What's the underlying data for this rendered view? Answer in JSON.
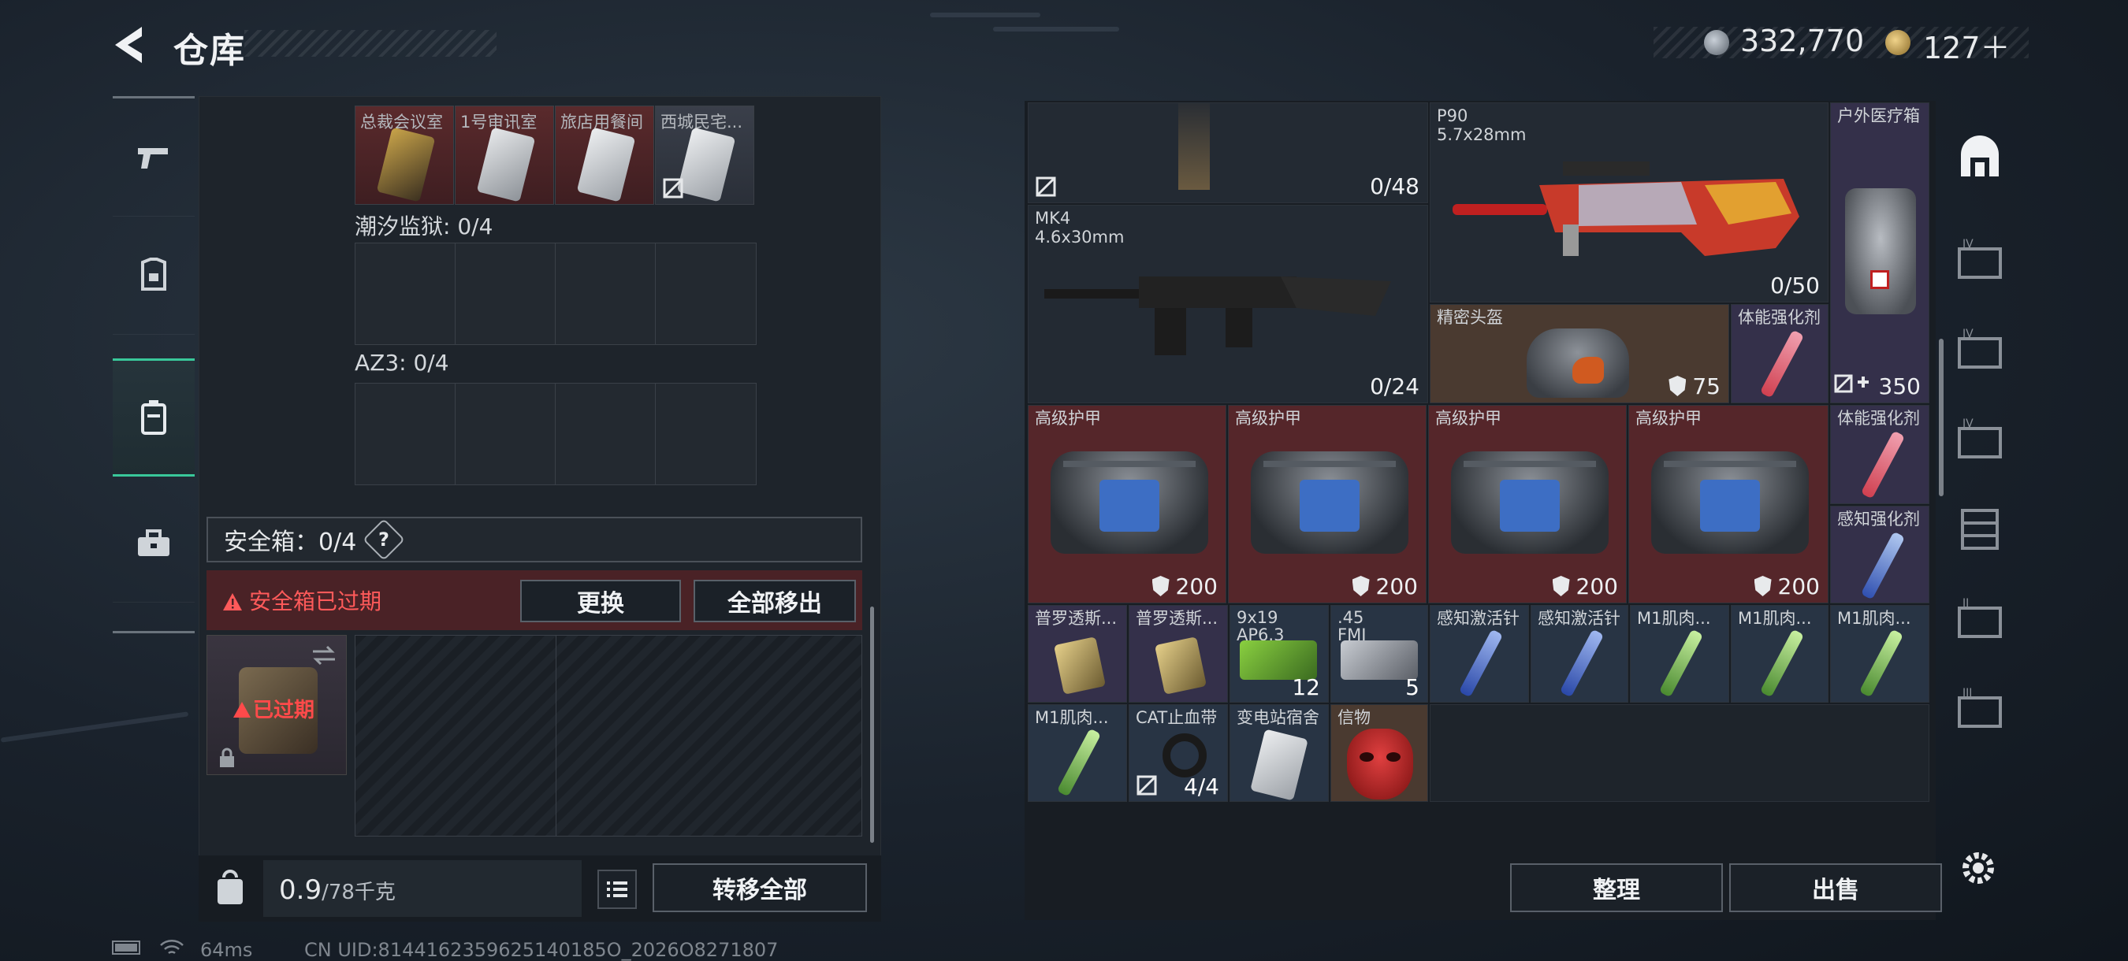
{
  "header": {
    "title": "仓库",
    "money": "332,770",
    "tokens": "127＋"
  },
  "keycards": [
    {
      "label": "总裁会议室",
      "color": "red"
    },
    {
      "label": "1号审讯室",
      "color": "red"
    },
    {
      "label": "旅店用餐间",
      "color": "red"
    },
    {
      "label": "西城民宅...",
      "color": "gray"
    }
  ],
  "sections": {
    "prison": "潮汐监狱: 0/4",
    "az3": "AZ3: 0/4"
  },
  "safebox": {
    "label": "安全箱：0/4",
    "help": "?",
    "expired_warning": "安全箱已过期",
    "swap_button": "更换",
    "move_all_button": "全部移出",
    "expired_tag": "已过期"
  },
  "weight": {
    "value": "0.9",
    "unit": "/78千克"
  },
  "transfer_all_button": "转移全部",
  "right_buttons": {
    "sort": "整理",
    "sell": "出售"
  },
  "items": {
    "mag_count": "0/48",
    "p90": {
      "name": "P90",
      "caliber": "5.7x28mm",
      "ammo": "0/50"
    },
    "medbox": {
      "name": "户外医疗箱",
      "value": "350"
    },
    "mk4": {
      "name": "MK4",
      "caliber": "4.6x30mm",
      "ammo": "0/24"
    },
    "helmet": {
      "name": "精密头盔",
      "armor": "75"
    },
    "stim_body1": {
      "name": "体能强化剂"
    },
    "stim_body2": {
      "name": "体能强化剂"
    },
    "stim_sense": {
      "name": "感知强化剂"
    },
    "armors": [
      {
        "name": "高级护甲",
        "armor": "200"
      },
      {
        "name": "高级护甲",
        "armor": "200"
      },
      {
        "name": "高级护甲",
        "armor": "200"
      },
      {
        "name": "高级护甲",
        "armor": "200"
      }
    ],
    "row3": [
      {
        "name": "普罗透斯...",
        "count": ""
      },
      {
        "name": "普罗透斯...",
        "count": ""
      },
      {
        "name": "9x19 AP6.3",
        "count": "12"
      },
      {
        "name": ".45 FMJ",
        "count": "5"
      },
      {
        "name": "感知激活针",
        "count": ""
      },
      {
        "name": "感知激活针",
        "count": ""
      },
      {
        "name": "M1肌肉...",
        "count": ""
      },
      {
        "name": "M1肌肉...",
        "count": ""
      },
      {
        "name": "M1肌肉...",
        "count": ""
      }
    ],
    "row4": [
      {
        "name": "M1肌肉...",
        "count": ""
      },
      {
        "name": "CAT止血带",
        "count": "4/4"
      },
      {
        "name": "变电站宿舍",
        "count": ""
      },
      {
        "name": "信物",
        "count": ""
      }
    ]
  },
  "status": {
    "ping": "64ms",
    "uid": "CN UID:8144162359625140185O_2026O8271807"
  },
  "colors": {
    "accent": "#39c89a",
    "danger": "#ff5a5a",
    "armor_bg": "#55262a"
  }
}
